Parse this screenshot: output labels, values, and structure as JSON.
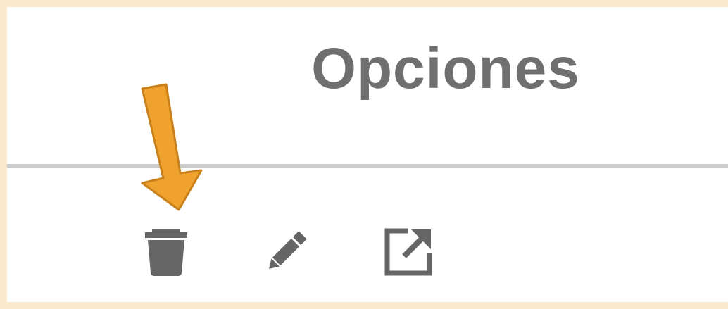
{
  "header": {
    "title": "Opciones"
  },
  "actions": [
    {
      "icon": "trash-icon",
      "action": "delete"
    },
    {
      "icon": "pencil-icon",
      "action": "edit"
    },
    {
      "icon": "external-link-icon",
      "action": "open"
    }
  ],
  "annotation": {
    "icon": "arrow-down-icon",
    "color": "#f0a22e"
  },
  "colors": {
    "frame": "#fbe9cf",
    "panel": "#ffffff",
    "icon": "#666666",
    "divider": "#cccccc"
  }
}
